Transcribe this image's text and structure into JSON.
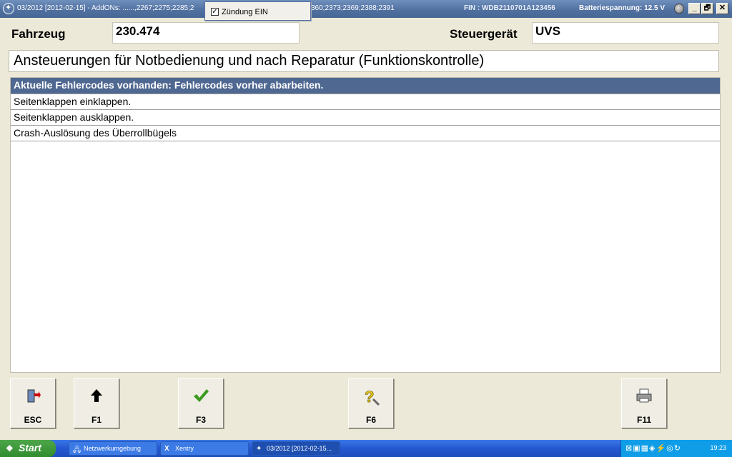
{
  "window": {
    "title_left": "03/2012 [2012-02-15] - AddONs: ......,2267;2275;2285;2",
    "title_right": "360;2373;2369;2388;2391",
    "fin": "FIN : WDB2110701A123456",
    "battery": "Batteriespannung: 12.5 V",
    "buttons": {
      "minimize": "_",
      "restore": "🗗",
      "close": "✕"
    }
  },
  "popup": {
    "checked": true,
    "label": "Zündung EIN"
  },
  "header": {
    "vehicle_label": "Fahrzeug",
    "vehicle_value": "230.474",
    "ecu_label": "Steuergerät",
    "ecu_value": "UVS",
    "heading": "Ansteuerungen für Notbedienung und nach Reparatur (Funktionskontrolle)"
  },
  "list": {
    "items": [
      {
        "label": "Aktuelle Fehlercodes vorhanden: Fehlercodes vorher abarbeiten.",
        "selected": true
      },
      {
        "label": "Seitenklappen einklappen."
      },
      {
        "label": "Seitenklappen ausklappen."
      },
      {
        "label": "Crash-Auslösung des Überrollbügels"
      }
    ]
  },
  "function_keys": [
    {
      "label": "ESC",
      "icon": "exit-door-icon"
    },
    {
      "label": "F1",
      "icon": "arrow-up-icon"
    },
    {
      "label": "F3",
      "icon": "checkmark-icon"
    },
    {
      "label": "F6",
      "icon": "help-question-icon"
    },
    {
      "label": "F11",
      "icon": "printer-icon"
    }
  ],
  "taskbar": {
    "start_label": "Start",
    "tasks": [
      {
        "label": "Netzwerkumgebung",
        "icon": "network-icon"
      },
      {
        "label": "Xentry",
        "icon": "xentry-icon"
      },
      {
        "label": "03/2012 [2012-02-15...",
        "icon": "star-logo-icon"
      }
    ],
    "clock": "19:23"
  }
}
